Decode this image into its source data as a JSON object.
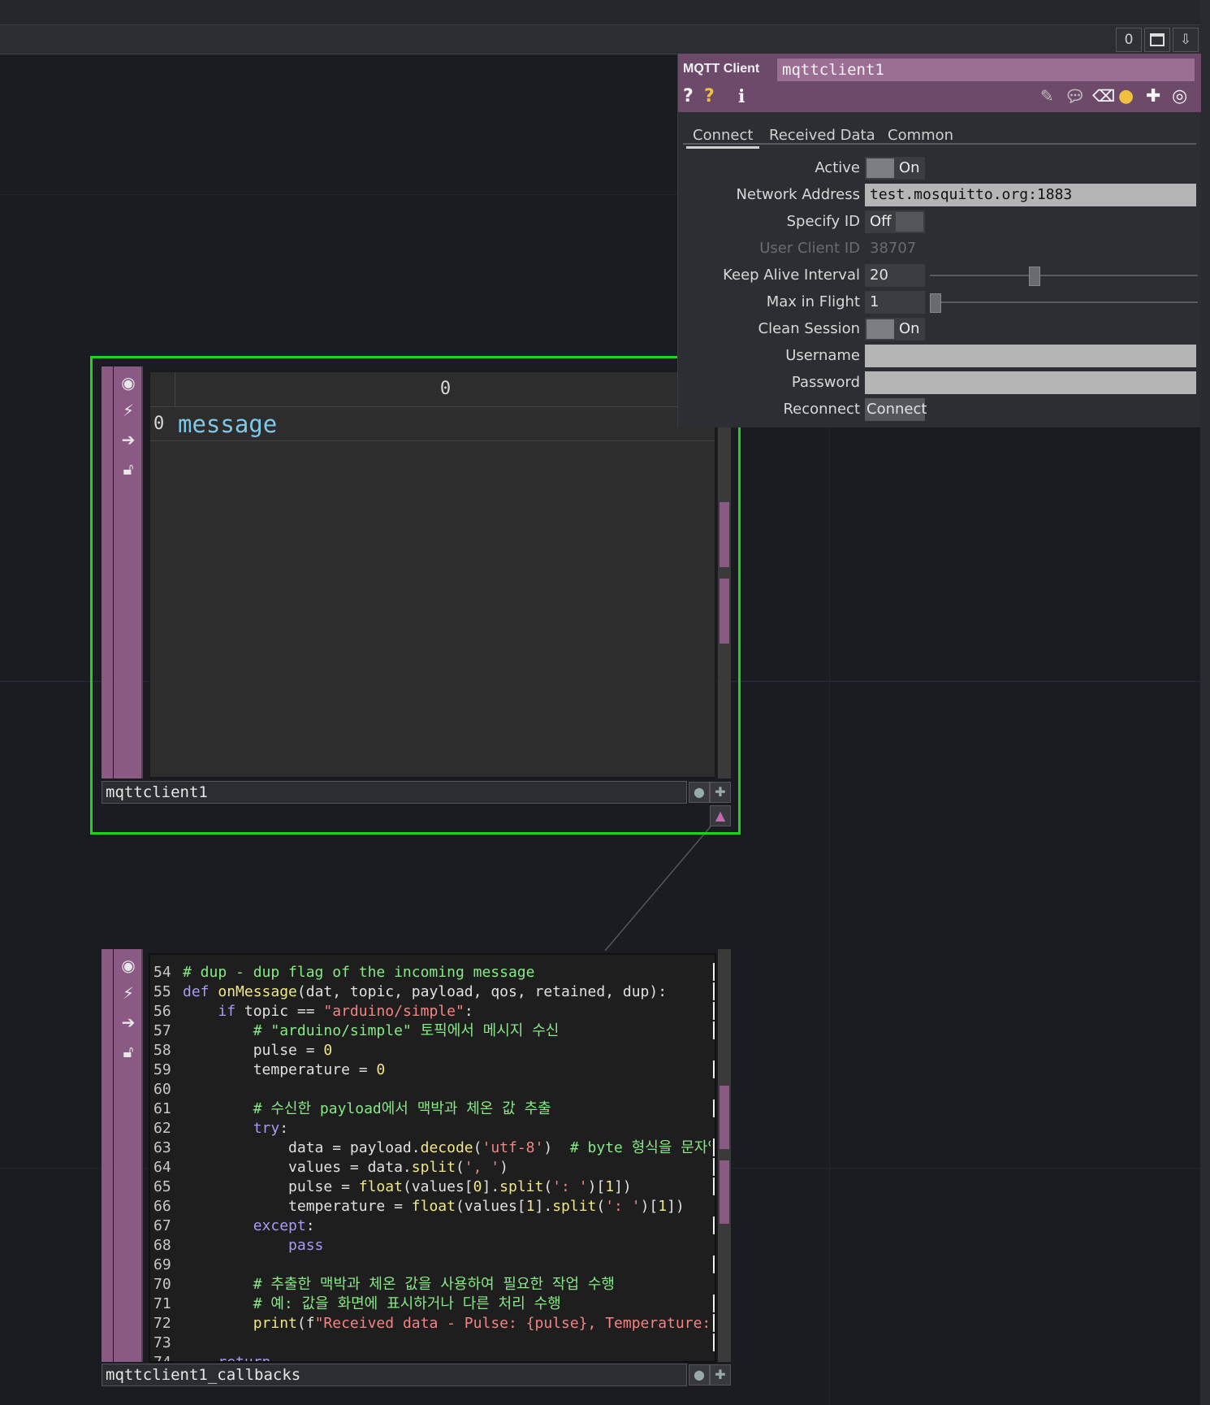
{
  "toolbar": {
    "counter": "0",
    "window_icon": "window-icon",
    "pin_icon": "pin-down-icon"
  },
  "panel": {
    "op_type": "MQTT Client",
    "op_name": "mqttclient1",
    "tabs": [
      "Connect",
      "Received Data",
      "Common"
    ],
    "params": {
      "active_label": "Active",
      "active_value": "On",
      "address_label": "Network Address",
      "address_value": "test.mosquitto.org:1883",
      "specify_id_label": "Specify ID",
      "specify_id_value": "Off",
      "user_client_id_label": "User Client ID",
      "user_client_id_value": "38707",
      "keep_alive_label": "Keep Alive Interval",
      "keep_alive_value": "20",
      "max_in_flight_label": "Max in Flight",
      "max_in_flight_value": "1",
      "clean_session_label": "Clean Session",
      "clean_session_value": "On",
      "username_label": "Username",
      "username_value": "",
      "password_label": "Password",
      "password_value": "",
      "reconnect_label": "Reconnect",
      "reconnect_button": "Connect"
    }
  },
  "node1": {
    "name": "mqttclient1",
    "col_header": "0",
    "row_index": "0",
    "cell_value": "message"
  },
  "node2": {
    "name": "mqttclient1_callbacks",
    "lines": [
      {
        "n": "54",
        "html": "<span class='cm'># dup - dup flag of the incoming message</span>"
      },
      {
        "n": "55",
        "html": "<span class='kw'>def</span> <span class='fn'>onMessage</span>(dat, topic, payload, qos, retained, dup):"
      },
      {
        "n": "56",
        "html": "    <span class='kw'>if</span> topic == <span class='st'>\"arduino/simple\"</span>:"
      },
      {
        "n": "57",
        "html": "        <span class='cm'># \"arduino/simple\" 토픽에서 메시지 수신</span>"
      },
      {
        "n": "58",
        "html": "        pulse = <span class='nm'>0</span>"
      },
      {
        "n": "59",
        "html": "        temperature = <span class='nm'>0</span>"
      },
      {
        "n": "60",
        "html": ""
      },
      {
        "n": "61",
        "html": "        <span class='cm'># 수신한 payload에서 맥박과 체온 값 추출</span>"
      },
      {
        "n": "62",
        "html": "        <span class='kw'>try</span>:"
      },
      {
        "n": "63",
        "html": "            data = payload.<span class='fn'>decode</span>(<span class='st'>'utf-8'</span>)  <span class='cm'># byte 형식을 문자열</span>"
      },
      {
        "n": "64",
        "html": "            values = data.<span class='fn'>split</span>(<span class='st'>', '</span>)"
      },
      {
        "n": "65",
        "html": "            pulse = <span class='fn'>float</span>(values[<span class='nm'>0</span>].<span class='fn'>split</span>(<span class='st'>': '</span>)[<span class='nm'>1</span>])"
      },
      {
        "n": "66",
        "html": "            temperature = <span class='fn'>float</span>(values[<span class='nm'>1</span>].<span class='fn'>split</span>(<span class='st'>': '</span>)[<span class='nm'>1</span>])"
      },
      {
        "n": "67",
        "html": "        <span class='kw'>except</span>:"
      },
      {
        "n": "68",
        "html": "            <span class='kw'>pass</span>"
      },
      {
        "n": "69",
        "html": ""
      },
      {
        "n": "70",
        "html": "        <span class='cm'># 추출한 맥박과 체온 값을 사용하여 필요한 작업 수행</span>"
      },
      {
        "n": "71",
        "html": "        <span class='cm'># 예: 값을 화면에 표시하거나 다른 처리 수행</span>"
      },
      {
        "n": "72",
        "html": "        <span class='fn'>print</span>(f<span class='st'>\"Received data - Pulse: {pulse}, Temperature:</span>"
      },
      {
        "n": "73",
        "html": ""
      },
      {
        "n": "74",
        "html": "    <span class='kw'>return</span>"
      }
    ]
  },
  "colors": {
    "selection": "#22d022",
    "op_purple": "#8a5a84",
    "header_purple": "#6e4a6a"
  }
}
